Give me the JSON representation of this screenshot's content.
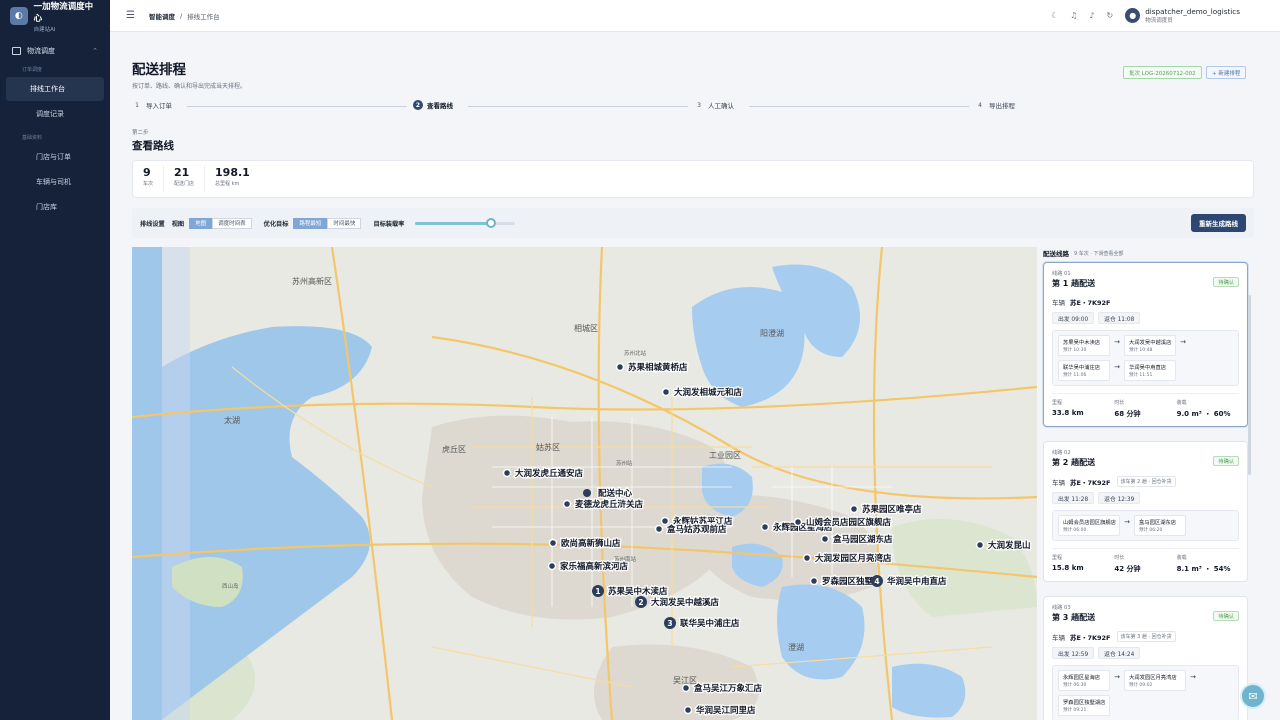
{
  "app": {
    "title": "一加物流调度中心",
    "subtitle": "自建站AI",
    "logo_icon": "truck-logo"
  },
  "sidebar": {
    "group_label": "物流调度",
    "sections": [
      {
        "title": "订单调度",
        "items": [
          {
            "label": "排线工作台",
            "active": true
          },
          {
            "label": "调度记录",
            "active": false
          }
        ]
      },
      {
        "title": "基础资料",
        "items": [
          {
            "label": "门店与订单",
            "active": false
          },
          {
            "label": "车辆与司机",
            "active": false
          },
          {
            "label": "门店库",
            "active": false
          }
        ]
      }
    ]
  },
  "topbar": {
    "breadcrumb": [
      "智能调度",
      "排线工作台"
    ],
    "user_name": "dispatcher_demo_logistics",
    "user_role": "物流调度员"
  },
  "page": {
    "title": "配送排程",
    "subtitle": "按订单、路线、确认和导出完成当天排程。",
    "batch_label": "批次 LOG-20260712-002",
    "new_button": "+ 新建排程",
    "steps": [
      {
        "num": "1",
        "label": "导入订单"
      },
      {
        "num": "2",
        "label": "查看路线",
        "active": true
      },
      {
        "num": "3",
        "label": "人工确认"
      },
      {
        "num": "4",
        "label": "导出排程"
      }
    ],
    "step_caption": "第二步",
    "section_title": "查看路线"
  },
  "stats": [
    {
      "value": "9",
      "label": "车次"
    },
    {
      "value": "21",
      "label": "配送门店"
    },
    {
      "value": "198.1",
      "label": "总里程 km"
    }
  ],
  "controls": {
    "settings_label": "排线设置",
    "view_label": "视图",
    "view_options": [
      "地图",
      "调度时间表"
    ],
    "opt_label": "优化目标",
    "opt_options": [
      "路程最短",
      "时间最快"
    ],
    "load_label": "目标装载率",
    "load_value": 0.76,
    "regen_button": "重新生成路线"
  },
  "map": {
    "labels": {
      "center": "配送中心"
    },
    "places": [
      "苏州高新区",
      "相城区",
      "阳澄湖",
      "太湖",
      "虎丘区",
      "姑苏区",
      "工业园区",
      "吴江区",
      "西山岛",
      "澄湖",
      "苏州北站",
      "苏州站",
      "苏州南站"
    ],
    "stores": [
      "苏果相城黄桥店",
      "大润发相城元和店",
      "大润发虎丘通安店",
      "麦德龙虎丘浒关店",
      "永辉姑苏平江店",
      "永辉园区星海店",
      "欧尚高新狮山店",
      "家乐福高新滨河店",
      "苏果吴中木渎店",
      "大润发吴中越溪店",
      "联华吴中浦庄店",
      "苏果园区唯亭店",
      "山姆会员店园区旗舰店",
      "盒马园区湖东店",
      "大润发园区月亮湾店",
      "罗森园区独墅湖",
      "华润吴中甪直店",
      "大润发昆山",
      "盒马吴江万象汇店",
      "华润吴江同里店",
      "盒马姑苏观前店"
    ]
  },
  "routes_panel": {
    "title": "配送线路",
    "subtitle": "9 车次 · 下滑查看全部",
    "cards": [
      {
        "id": "线路 01",
        "name": "第 1 趟配送",
        "status": "待确认",
        "vehicle_label": "车辆",
        "plate": "苏E・7K92F",
        "note": "",
        "depart": "出发 09:00",
        "return": "返仓 11:08",
        "stops": [
          {
            "name": "苏果吴中木渎店",
            "eta": "预计 10:30"
          },
          {
            "name": "大润发吴中越溪店",
            "eta": "预计 10:48"
          },
          {
            "name": "联华吴中浦庄店",
            "eta": "预计 11:06"
          },
          {
            "name": "华润吴中甪直店",
            "eta": "预计 11:51"
          }
        ],
        "metrics": [
          {
            "label": "里程",
            "value": "33.8 km"
          },
          {
            "label": "时长",
            "value": "68 分钟"
          },
          {
            "label": "装载",
            "value": "9.0 m³ ・ 60%"
          }
        ]
      },
      {
        "id": "线路 02",
        "name": "第 2 趟配送",
        "status": "待确认",
        "vehicle_label": "车辆",
        "plate": "苏E・7K92F",
        "note": "该车第 2 趟 · 回仓补货",
        "depart": "出发 11:28",
        "return": "返仓 12:39",
        "stops": [
          {
            "name": "山姆会员店园区旗舰店",
            "eta": "预计 06:00"
          },
          {
            "name": "盒马园区湖东店",
            "eta": "预计 06:20"
          }
        ],
        "metrics": [
          {
            "label": "里程",
            "value": "15.8 km"
          },
          {
            "label": "时长",
            "value": "42 分钟"
          },
          {
            "label": "装载",
            "value": "8.1 m³ ・ 54%"
          }
        ]
      },
      {
        "id": "线路 03",
        "name": "第 3 趟配送",
        "status": "待确认",
        "vehicle_label": "车辆",
        "plate": "苏E・7K92F",
        "note": "该车第 3 趟 · 回仓补货",
        "depart": "出发 12:59",
        "return": "返仓 14:24",
        "stops": [
          {
            "name": "永辉园区星海店",
            "eta": "预计 06:30"
          },
          {
            "name": "大润发园区月亮湾店",
            "eta": "预计 09:02"
          },
          {
            "name": "罗森园区独墅湖店",
            "eta": "预计 09:21"
          }
        ],
        "metrics": []
      }
    ]
  }
}
